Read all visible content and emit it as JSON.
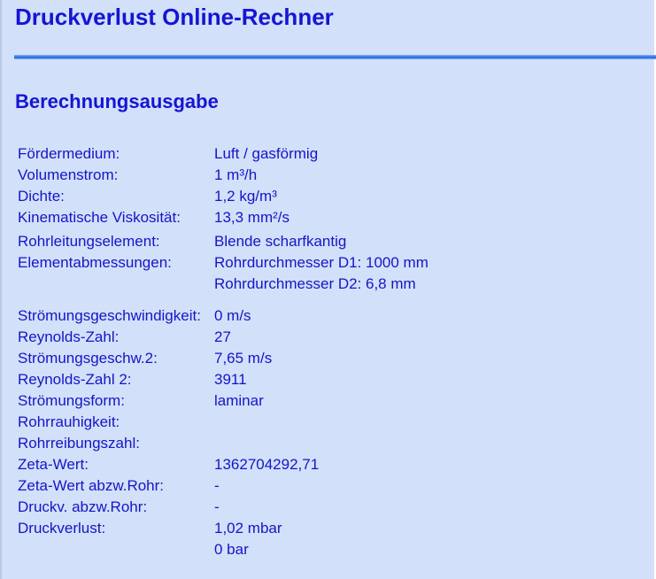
{
  "header": {
    "title": "Druckverlust Online-Rechner"
  },
  "output": {
    "heading": "Berechnungsausgabe",
    "rows": [
      {
        "label": "Fördermedium:",
        "value": "Luft / gasförmig"
      },
      {
        "label": "Volumenstrom:",
        "value": "1 m³/h"
      },
      {
        "label": "Dichte:",
        "value": "1,2 kg/m³"
      },
      {
        "label": "Kinematische Viskosität:",
        "value": "13,3 mm²/s"
      },
      {
        "label": "Rohrleitungselement:",
        "value": "Blende scharfkantig"
      },
      {
        "label": "Elementabmessungen:",
        "value": "Rohrdurchmesser D1: 1000 mm"
      },
      {
        "label": "",
        "value": "Rohrdurchmesser D2: 6,8 mm"
      },
      {
        "label": "Strömungsgeschwindigkeit:",
        "value": "0 m/s"
      },
      {
        "label": "Reynolds-Zahl:",
        "value": "27"
      },
      {
        "label": "Strömungsgeschw.2:",
        "value": "7,65 m/s"
      },
      {
        "label": "Reynolds-Zahl 2:",
        "value": "3911"
      },
      {
        "label": "Strömungsform:",
        "value": "laminar"
      },
      {
        "label": "Rohrrauhigkeit:",
        "value": ""
      },
      {
        "label": "Rohrreibungszahl:",
        "value": ""
      },
      {
        "label": "Zeta-Wert:",
        "value": "1362704292,71"
      },
      {
        "label": "Zeta-Wert abzw.Rohr:",
        "value": "-"
      },
      {
        "label": "Druckv. abzw.Rohr:",
        "value": "-"
      },
      {
        "label": "Druckverlust:",
        "value": "1,02 mbar"
      },
      {
        "label": "",
        "value": "0 bar"
      }
    ]
  }
}
